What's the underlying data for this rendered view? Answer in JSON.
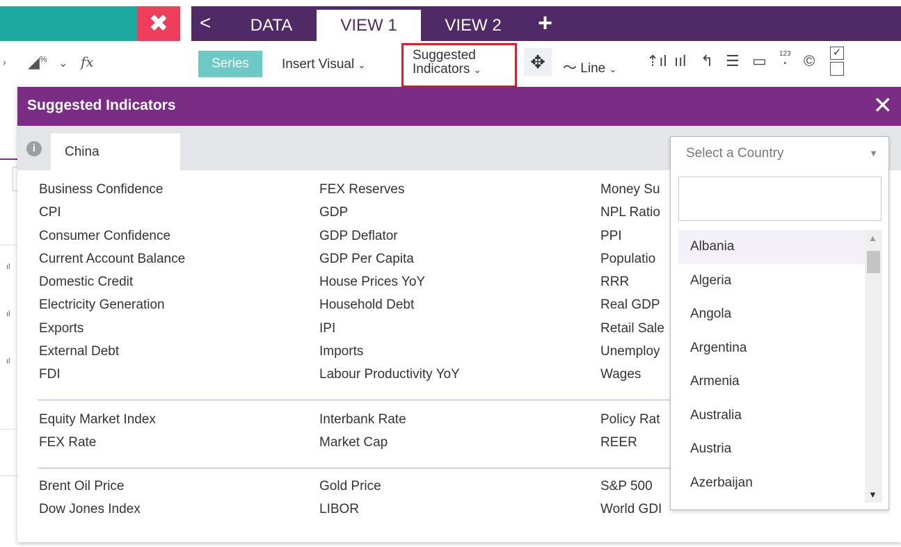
{
  "app": {
    "left_icons": {
      "fx": "fx",
      "percent": "%",
      "chev": "⌄"
    },
    "tabs": [
      {
        "label": "DATA"
      },
      {
        "label": "VIEW 1"
      },
      {
        "label": "VIEW 2"
      }
    ],
    "add_tab": "+",
    "back_icon": "<"
  },
  "toolbar": {
    "series": "Series",
    "insert_visual": "Insert Visual",
    "suggested_line1": "Suggested",
    "suggested_line2": "Indicators",
    "line": "Line",
    "badge_123": "123"
  },
  "modal": {
    "title": "Suggested Indicators",
    "close": "✕",
    "country_tab": "China",
    "info": "i",
    "groups": [
      {
        "col1": [
          "Business Confidence",
          "CPI",
          "Consumer Confidence",
          "Current Account Balance",
          "Domestic Credit",
          "Electricity Generation",
          "Exports",
          "External Debt",
          "FDI"
        ],
        "col2": [
          "FEX Reserves",
          "GDP",
          "GDP Deflator",
          "GDP Per Capita",
          "House Prices YoY",
          "Household Debt",
          "IPI",
          "Imports",
          "Labour Productivity YoY"
        ],
        "col3": [
          "Money Su",
          "NPL Ratio",
          "PPI",
          "Populatio",
          "RRR",
          "Real GDP",
          "Retail Sale",
          "Unemploy",
          "Wages"
        ]
      },
      {
        "col1": [
          "Equity Market Index",
          "FEX Rate"
        ],
        "col2": [
          "Interbank Rate",
          "Market Cap"
        ],
        "col3": [
          "Policy Rat",
          "REER"
        ]
      },
      {
        "col1": [
          "Brent Oil Price",
          "Dow Jones Index"
        ],
        "col2": [
          "Gold Price",
          "LIBOR"
        ],
        "col3": [
          "S&P 500",
          "World GDI"
        ]
      }
    ]
  },
  "country_select": {
    "placeholder": "Select a Country",
    "search_value": "",
    "options": [
      "Albania",
      "Algeria",
      "Angola",
      "Argentina",
      "Armenia",
      "Australia",
      "Austria",
      "Azerbaijan"
    ]
  },
  "colors": {
    "purple_dark": "#4f2a66",
    "purple_header": "#7b2d86",
    "teal": "#1ba9a0",
    "red": "#ef3e5b",
    "highlight_border": "#e11d2b"
  }
}
